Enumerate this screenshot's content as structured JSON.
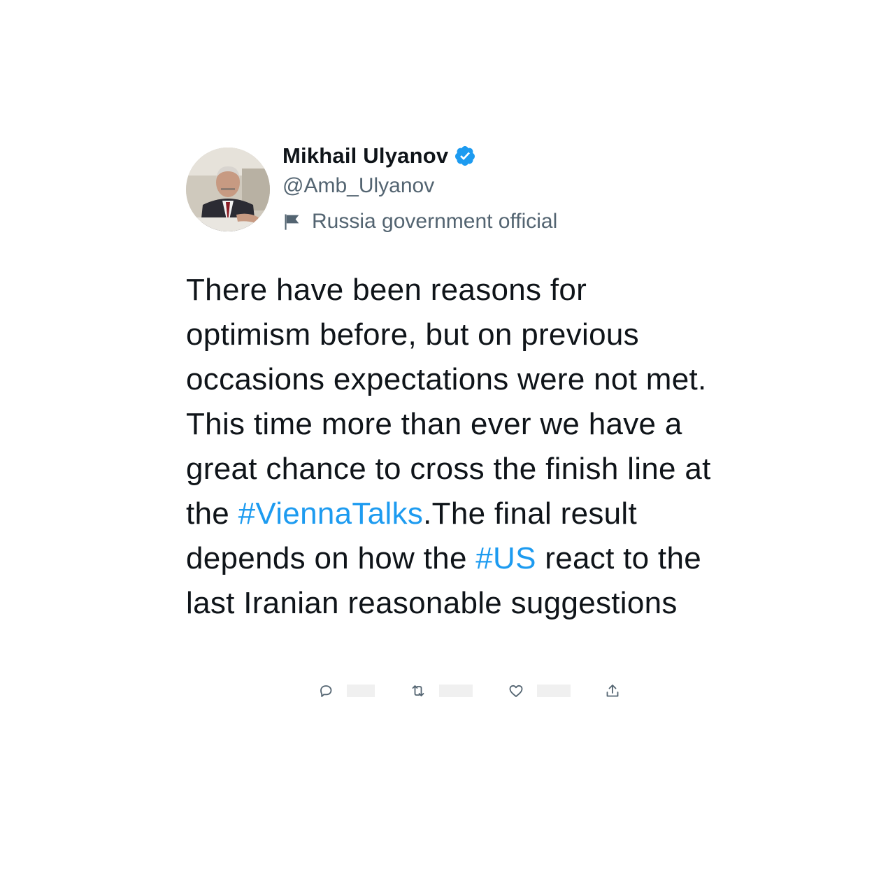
{
  "author": {
    "display_name": "Mikhail Ulyanov",
    "handle": "@Amb_Ulyanov",
    "label": "Russia government official",
    "verified": true
  },
  "tweet": {
    "segments": [
      {
        "text": "There have been reasons for optimism before, but on previous occasions expectations were not met. This time  more than ever we have a great chance to cross the finish line at the ",
        "type": "text"
      },
      {
        "text": "#ViennaTalks",
        "type": "hashtag"
      },
      {
        "text": ".The final result depends on how the ",
        "type": "text"
      },
      {
        "text": "#US",
        "type": "hashtag"
      },
      {
        "text": " react to the last Iranian reasonable suggestions",
        "type": "text"
      }
    ]
  },
  "actions": {
    "reply_icon": "reply-icon",
    "retweet_icon": "retweet-icon",
    "like_icon": "heart-icon",
    "share_icon": "share-icon"
  },
  "colors": {
    "accent": "#1d9bf0",
    "text": "#0f1419",
    "secondary": "#536471"
  }
}
